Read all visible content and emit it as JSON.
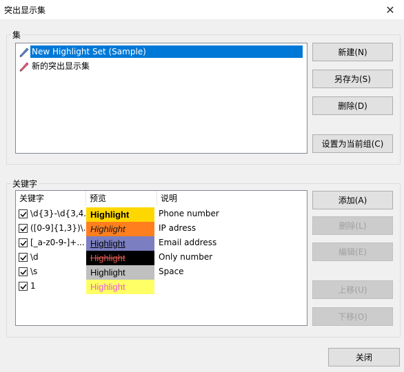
{
  "window": {
    "title": "突出显示集",
    "close_label": "✕"
  },
  "sets_group": {
    "label": "集",
    "items": [
      {
        "label": "New Highlight Set (Sample)",
        "selected": true
      },
      {
        "label": "新的突出显示集",
        "selected": false
      }
    ],
    "buttons": {
      "new": "新建(N)",
      "save_as": "另存为(S)",
      "delete": "删除(D)",
      "set_current": "设置为当前组(C)"
    }
  },
  "keywords_group": {
    "label": "关键字",
    "columns": {
      "keyword": "关键字",
      "preview": "预览",
      "description": "说明"
    },
    "rows": [
      {
        "checked": true,
        "keyword": "\\d{3}-\\d{3,4...",
        "preview": "Highlight",
        "bg": "#ffd700",
        "fg": "#000000",
        "style": "bold",
        "description": "Phone number"
      },
      {
        "checked": true,
        "keyword": "([0-9]{1,3})\\...",
        "preview": "Highlight",
        "bg": "#ff7f1e",
        "fg": "#1a1a1a",
        "style": "italic",
        "description": "IP adress"
      },
      {
        "checked": true,
        "keyword": "[_a-z0-9-]+...",
        "preview": "Highlight",
        "bg": "#7b7fc1",
        "fg": "#000000",
        "style": "underline",
        "description": "Email address"
      },
      {
        "checked": true,
        "keyword": "\\d",
        "preview": "Highlight",
        "bg": "#000000",
        "fg": "#e05a50",
        "style": "strike",
        "description": "Only number"
      },
      {
        "checked": true,
        "keyword": "\\s",
        "preview": "Highlight",
        "bg": "#c0c0c0",
        "fg": "#000000",
        "style": "normal",
        "description": "Space"
      },
      {
        "checked": true,
        "keyword": "1",
        "preview": "Highlight",
        "bg": "#ffff66",
        "fg": "#e85ad8",
        "style": "normal",
        "description": ""
      }
    ],
    "buttons": {
      "add": "添加(A)",
      "delete": "删除(L)",
      "edit": "编辑(E)",
      "move_up": "上移(U)",
      "move_down": "下移(O)"
    }
  },
  "footer": {
    "close": "关闭"
  }
}
